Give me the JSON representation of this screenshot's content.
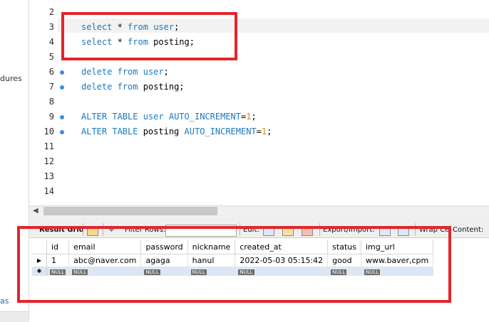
{
  "navigator": {
    "procedures_text": "dures",
    "bottom_tab_text": "as"
  },
  "editor": {
    "lines": [
      {
        "n": "2",
        "dot": false,
        "tokens": []
      },
      {
        "n": "3",
        "dot": false,
        "tokens": [
          [
            "kw",
            "select"
          ],
          [
            "t",
            " * "
          ],
          [
            "kw",
            "from"
          ],
          [
            "t",
            " "
          ],
          [
            "kw",
            "user"
          ],
          [
            "t",
            ";"
          ]
        ]
      },
      {
        "n": "4",
        "dot": false,
        "tokens": [
          [
            "kw",
            "select"
          ],
          [
            "t",
            " * "
          ],
          [
            "kw",
            "from"
          ],
          [
            "t",
            " posting;"
          ]
        ]
      },
      {
        "n": "5",
        "dot": false,
        "tokens": []
      },
      {
        "n": "6",
        "dot": true,
        "tokens": [
          [
            "kw",
            "delete"
          ],
          [
            "t",
            " "
          ],
          [
            "kw",
            "from"
          ],
          [
            "t",
            " "
          ],
          [
            "kw",
            "user"
          ],
          [
            "t",
            ";"
          ]
        ]
      },
      {
        "n": "7",
        "dot": true,
        "tokens": [
          [
            "kw",
            "delete"
          ],
          [
            "t",
            " "
          ],
          [
            "kw",
            "from"
          ],
          [
            "t",
            " posting;"
          ]
        ]
      },
      {
        "n": "8",
        "dot": false,
        "tokens": []
      },
      {
        "n": "9",
        "dot": true,
        "tokens": [
          [
            "kw",
            "ALTER TABLE"
          ],
          [
            "t",
            " "
          ],
          [
            "kw",
            "user"
          ],
          [
            "t",
            " "
          ],
          [
            "kw",
            "AUTO_INCREMENT"
          ],
          [
            "t",
            "="
          ],
          [
            "num",
            "1"
          ],
          [
            "t",
            ";"
          ]
        ]
      },
      {
        "n": "10",
        "dot": true,
        "tokens": [
          [
            "kw",
            "ALTER TABLE"
          ],
          [
            "t",
            " posting "
          ],
          [
            "kw",
            "AUTO_INCREMENT"
          ],
          [
            "t",
            "="
          ],
          [
            "num",
            "1"
          ],
          [
            "t",
            ";"
          ]
        ]
      },
      {
        "n": "11",
        "dot": false,
        "tokens": []
      },
      {
        "n": "12",
        "dot": false,
        "tokens": []
      },
      {
        "n": "13",
        "dot": false,
        "tokens": []
      },
      {
        "n": "14",
        "dot": false,
        "tokens": []
      }
    ]
  },
  "toolbar": {
    "result_grid": "Result Grid",
    "filter_rows": "Filter Rows:",
    "edit": "Edit:",
    "export_import": "Export/Import:",
    "wrap_cell": "Wrap Ce",
    "content": "Content:"
  },
  "grid": {
    "columns": [
      "id",
      "email",
      "password",
      "nickname",
      "created_at",
      "status",
      "img_url"
    ],
    "rows": [
      [
        "1",
        "abc@naver.com",
        "agaga",
        "hanul",
        "2022-05-03 05:15:42",
        "good",
        "www.baver,cpm"
      ]
    ],
    "null_label": "NULL"
  },
  "colors": {
    "keyword": "#1d79c0",
    "number": "#e08a00",
    "annotation": "#e3252b"
  }
}
